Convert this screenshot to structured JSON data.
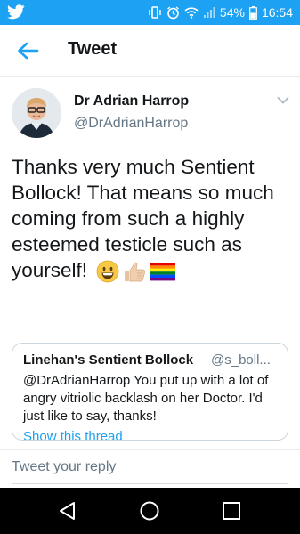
{
  "status_bar": {
    "battery": "54%",
    "time": "16:54"
  },
  "app_bar": {
    "title": "Tweet"
  },
  "tweet": {
    "author_name": "Dr Adrian Harrop",
    "author_handle": "@DrAdrianHarrop",
    "text": "Thanks very much Sentient Bollock! That means so much coming from such a highly esteemed testicle such as yourself!",
    "emojis": [
      "grinning-face",
      "thumbs-up",
      "rainbow-flag"
    ]
  },
  "quoted_tweet": {
    "name": "Linehan's Sentient Bollock",
    "handle": "@s_boll...",
    "text": "@DrAdrianHarrop You put up with a lot of angry vitriolic backlash on her Doctor. I'd just like to say, thanks!",
    "link": "Show this thread"
  },
  "reply": {
    "placeholder": "Tweet your reply"
  },
  "colors": {
    "brand_blue": "#1da1f2",
    "secondary_text": "#657786",
    "nav_background": "#000000"
  }
}
